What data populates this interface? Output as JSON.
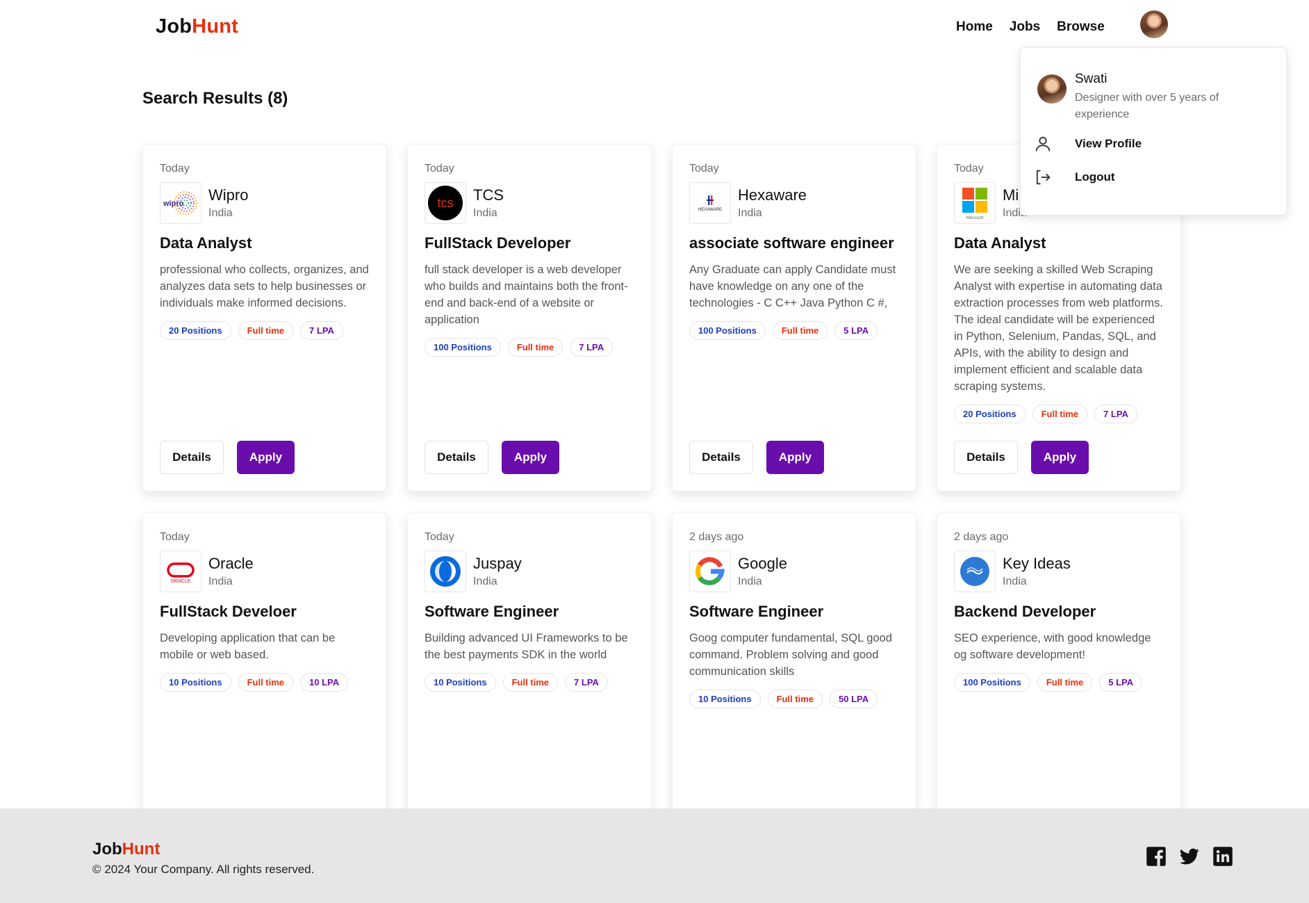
{
  "header": {
    "logo_part1": "Job",
    "logo_part2": "Hunt",
    "nav": [
      "Home",
      "Jobs",
      "Browse"
    ]
  },
  "page_title": "Search Results (8)",
  "jobs": [
    {
      "posted": "Today",
      "company": "Wipro",
      "location": "India",
      "role": "Data Analyst",
      "description": "professional who collects, organizes, and analyzes data sets to help businesses or individuals make informed decisions.",
      "positions": "20 Positions",
      "type": "Full time",
      "salary": "7 LPA",
      "logo_icon": "wipro-logo-icon",
      "logo_text": "wipro"
    },
    {
      "posted": "Today",
      "company": "TCS",
      "location": "India",
      "role": "FullStack Developer",
      "description": "full stack developer is a web developer who builds and maintains both the front-end and back-end of a website or application",
      "positions": "100 Positions",
      "type": "Full time",
      "salary": "7 LPA",
      "logo_icon": "tcs-logo-icon",
      "logo_text": "tcs"
    },
    {
      "posted": "Today",
      "company": "Hexaware",
      "location": "India",
      "role": "associate software engineer",
      "description": "Any Graduate can apply Candidate must have knowledge on any one of the technologies - C C++ Java Python C #,",
      "positions": "100 Positions",
      "type": "Full time",
      "salary": "5 LPA",
      "logo_icon": "hexaware-logo-icon",
      "logo_text": "HEXAWARE"
    },
    {
      "posted": "Today",
      "company": "Mi",
      "location": "India",
      "role": "Data Analyst",
      "description": "We are seeking a skilled Web Scraping Analyst with expertise in automating data extraction processes from web platforms. The ideal candidate will be experienced in Python, Selenium, Pandas, SQL, and APIs, with the ability to design and implement efficient and scalable data scraping systems.",
      "positions": "20 Positions",
      "type": "Full time",
      "salary": "7 LPA",
      "logo_icon": "microsoft-logo-icon",
      "logo_text": "Microsoft"
    },
    {
      "posted": "Today",
      "company": "Oracle",
      "location": "India",
      "role": "FullStack Develoer",
      "description": "Developing application that can be mobile or web based.",
      "positions": "10 Positions",
      "type": "Full time",
      "salary": "10 LPA",
      "logo_icon": "oracle-logo-icon",
      "logo_text": "ORACLE"
    },
    {
      "posted": "Today",
      "company": "Juspay",
      "location": "India",
      "role": "Software Engineer",
      "description": "Building advanced UI Frameworks to be the best payments SDK in the world",
      "positions": "10 Positions",
      "type": "Full time",
      "salary": "7 LPA",
      "logo_icon": "juspay-logo-icon"
    },
    {
      "posted": "2 days ago",
      "company": "Google",
      "location": "India",
      "role": "Software Engineer",
      "description": "Goog computer fundamental, SQL good command. Problem solving and good communication skills",
      "positions": "10 Positions",
      "type": "Full time",
      "salary": "50 LPA",
      "logo_icon": "google-logo-icon"
    },
    {
      "posted": "2 days ago",
      "company": "Key Ideas",
      "location": "India",
      "role": "Backend Developer",
      "description": "SEO experience, with good knowledge og software development!",
      "positions": "100 Positions",
      "type": "Full time",
      "salary": "5 LPA",
      "logo_icon": "keyideas-logo-icon"
    }
  ],
  "buttons": {
    "details": "Details",
    "apply": "Apply"
  },
  "profile_menu": {
    "name": "Swati",
    "bio": "Designer with over 5 years of experience",
    "view_profile": "View Profile",
    "logout": "Logout"
  },
  "footer": {
    "logo_part1": "Job",
    "logo_part2": "Hunt",
    "copyright": "© 2024 Your Company. All rights reserved.",
    "social": [
      "facebook-icon",
      "twitter-icon",
      "linkedin-icon"
    ]
  },
  "colors": {
    "accent": "#6a0dad",
    "brand_orange": "#e8300e",
    "positions_blue": "#1d3fbf",
    "salary_purple": "#6a0fb0",
    "footer_bg": "#e6e6e7"
  }
}
